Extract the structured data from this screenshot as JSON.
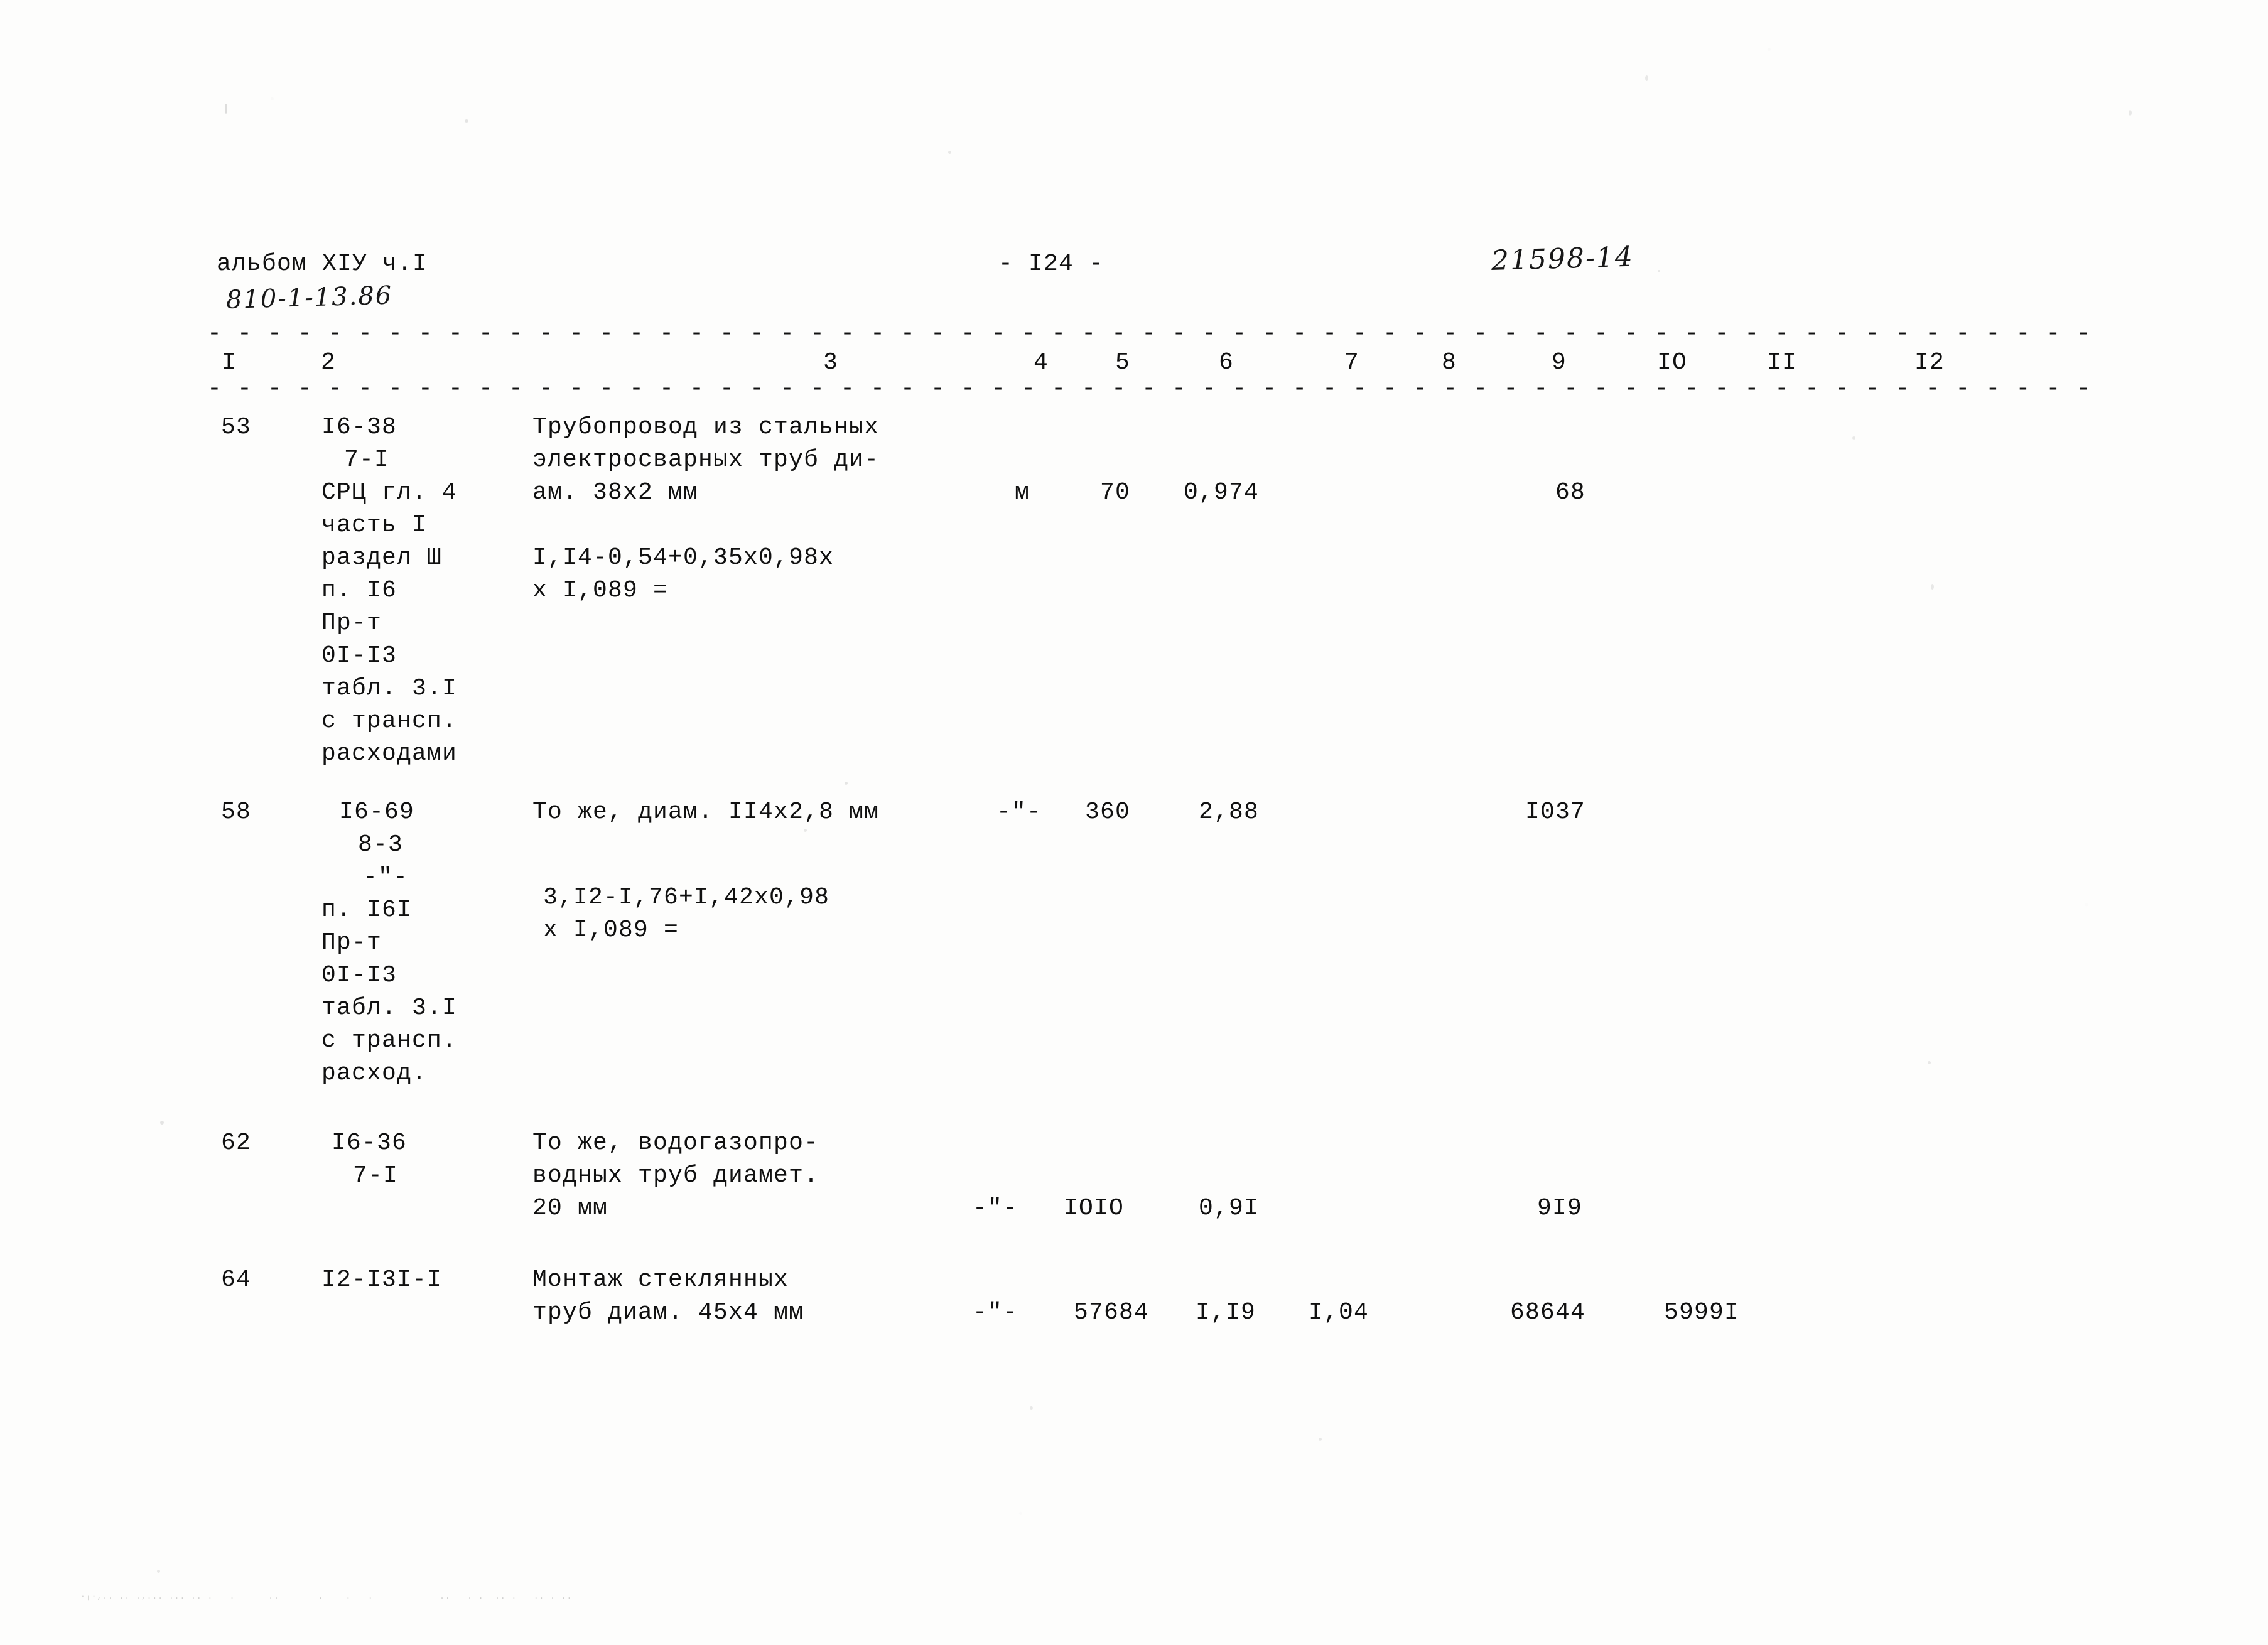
{
  "document": {
    "album_label": "альбом ХIУ ч.I",
    "album_code_handwritten": "810-1-13.86",
    "page_number": "- I24 -",
    "stamp_handwritten": "21598-14"
  },
  "table": {
    "column_headers": [
      "I",
      "2",
      "3",
      "4",
      "5",
      "6",
      "7",
      "8",
      "9",
      "IO",
      "II",
      "I2"
    ],
    "rule_dash": "- ",
    "rows": [
      {
        "col1": "53",
        "col2_lines": [
          "I6-38",
          "7-I",
          "СРЦ гл. 4",
          "часть I",
          "раздел Ш",
          "п. I6",
          "Пр-т",
          "0I-I3",
          "табл. 3.I",
          "с трансп.",
          "расходами"
        ],
        "col3_lines": [
          "Трубопровод из стальных",
          "электросварных труб ди-",
          "ам. 38х2 мм"
        ],
        "col3_formula": [
          "I,I4-0,54+0,35х0,98х",
          "х I,089 ="
        ],
        "col4": "м",
        "col5": "70",
        "col6": "0,974",
        "col7": "",
        "col8": "",
        "col9": "68",
        "col10": "",
        "col11": "",
        "col12": ""
      },
      {
        "col1": "58",
        "col2_lines": [
          "I6-69",
          "8-3",
          "-\"-",
          "п. I6I",
          "Пр-т",
          "0I-I3",
          "табл. 3.I",
          "с трансп.",
          "расход."
        ],
        "col3_lines": [
          "То же, диам. II4х2,8 мм"
        ],
        "col3_formula": [
          "3,I2-I,76+I,42х0,98",
          "х I,089 ="
        ],
        "col4": "-\"-",
        "col5": "360",
        "col6": "2,88",
        "col7": "",
        "col8": "",
        "col9": "I037",
        "col10": "",
        "col11": "",
        "col12": ""
      },
      {
        "col1": "62",
        "col2_lines": [
          "I6-36",
          "7-I"
        ],
        "col3_lines": [
          "То же, водогазопро-",
          "водных труб диамет.",
          "20 мм"
        ],
        "col3_formula": [],
        "col4": "-\"-",
        "col5": "IOIO",
        "col6": "0,9I",
        "col7": "",
        "col8": "",
        "col9": "9I9",
        "col10": "",
        "col11": "",
        "col12": ""
      },
      {
        "col1": "64",
        "col2_lines": [
          "I2-I3I-I"
        ],
        "col3_lines": [
          "Монтаж стеклянных",
          "труб диам. 45х4 мм"
        ],
        "col3_formula": [],
        "col4": "-\"-",
        "col5": "57684",
        "col6": "I,I9",
        "col7": "I,04",
        "col8": "",
        "col9": "68644",
        "col10": "5999I",
        "col11": "",
        "col12": ""
      }
    ]
  }
}
